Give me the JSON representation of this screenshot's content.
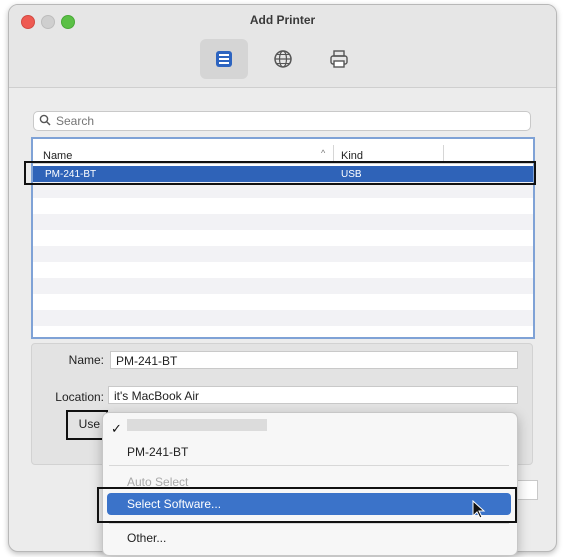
{
  "window": {
    "title": "Add Printer"
  },
  "toolbar": [
    {
      "name": "default-printers",
      "icon": "printer-default-icon",
      "selected": true
    },
    {
      "name": "ip-printers",
      "icon": "globe-icon",
      "selected": false
    },
    {
      "name": "windows-printers",
      "icon": "printer-icon",
      "selected": false
    }
  ],
  "search": {
    "placeholder": "Search",
    "value": ""
  },
  "table": {
    "columns": [
      "Name",
      "Kind"
    ],
    "sort_indicator": "^",
    "rows": [
      {
        "name": "PM-241-BT",
        "kind": "USB",
        "selected": true
      }
    ]
  },
  "details": {
    "name_label": "Name:",
    "name_value": "PM-241-BT",
    "location_label": "Location:",
    "location_value": "it's MacBook Air",
    "use_label": "Use"
  },
  "use_menu": {
    "checkmark": "✓",
    "items": [
      {
        "label": "PM-241-BT",
        "enabled": true
      },
      {
        "label": "Auto Select",
        "enabled": false
      },
      {
        "label": "Select Software...",
        "enabled": true,
        "highlighted": true
      },
      {
        "label": "Other...",
        "enabled": true
      }
    ]
  },
  "colors": {
    "selection": "#2f63b8",
    "menu_highlight": "#3b73c9",
    "close": "#ee5a52",
    "zoom": "#5bc046"
  }
}
